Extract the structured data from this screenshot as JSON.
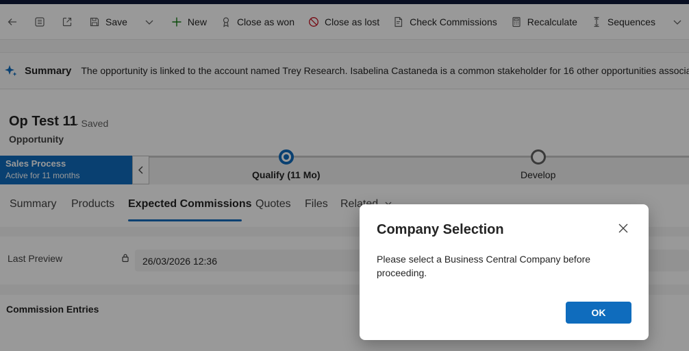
{
  "command_bar": {
    "save_label": "Save",
    "new_label": "New",
    "close_won_label": "Close as won",
    "close_lost_label": "Close as lost",
    "check_commissions_label": "Check Commissions",
    "recalculate_label": "Recalculate",
    "sequences_label": "Sequences"
  },
  "summary": {
    "title": "Summary",
    "text": "The opportunity is linked to the account named Trey Research. Isabelina Castaneda is a common stakeholder for 16 other opportunities associat"
  },
  "record": {
    "title": "Op Test 11",
    "saved_state": "- Saved",
    "entity": "Opportunity"
  },
  "process": {
    "name": "Sales Process",
    "duration": "Active for 11 months",
    "stages": [
      {
        "label": "Qualify  (11 Mo)",
        "active": true
      },
      {
        "label": "Develop",
        "active": false
      }
    ]
  },
  "tabs": [
    "Summary",
    "Products",
    "Expected Commissions",
    "Quotes",
    "Files",
    "Related"
  ],
  "active_tab": "Expected Commissions",
  "form": {
    "last_preview_label": "Last Preview",
    "last_preview_value": "26/03/2026 12:36",
    "commission_entries_title": "Commission Entries"
  },
  "dialog": {
    "title": "Company Selection",
    "message": "Please select a Business Central Company before proceeding.",
    "ok_label": "OK"
  },
  "colors": {
    "accent": "#0f6cbd",
    "top_bar": "#0f1a3a",
    "lost_icon": "#c50f1f",
    "new_icon": "#107c10"
  }
}
